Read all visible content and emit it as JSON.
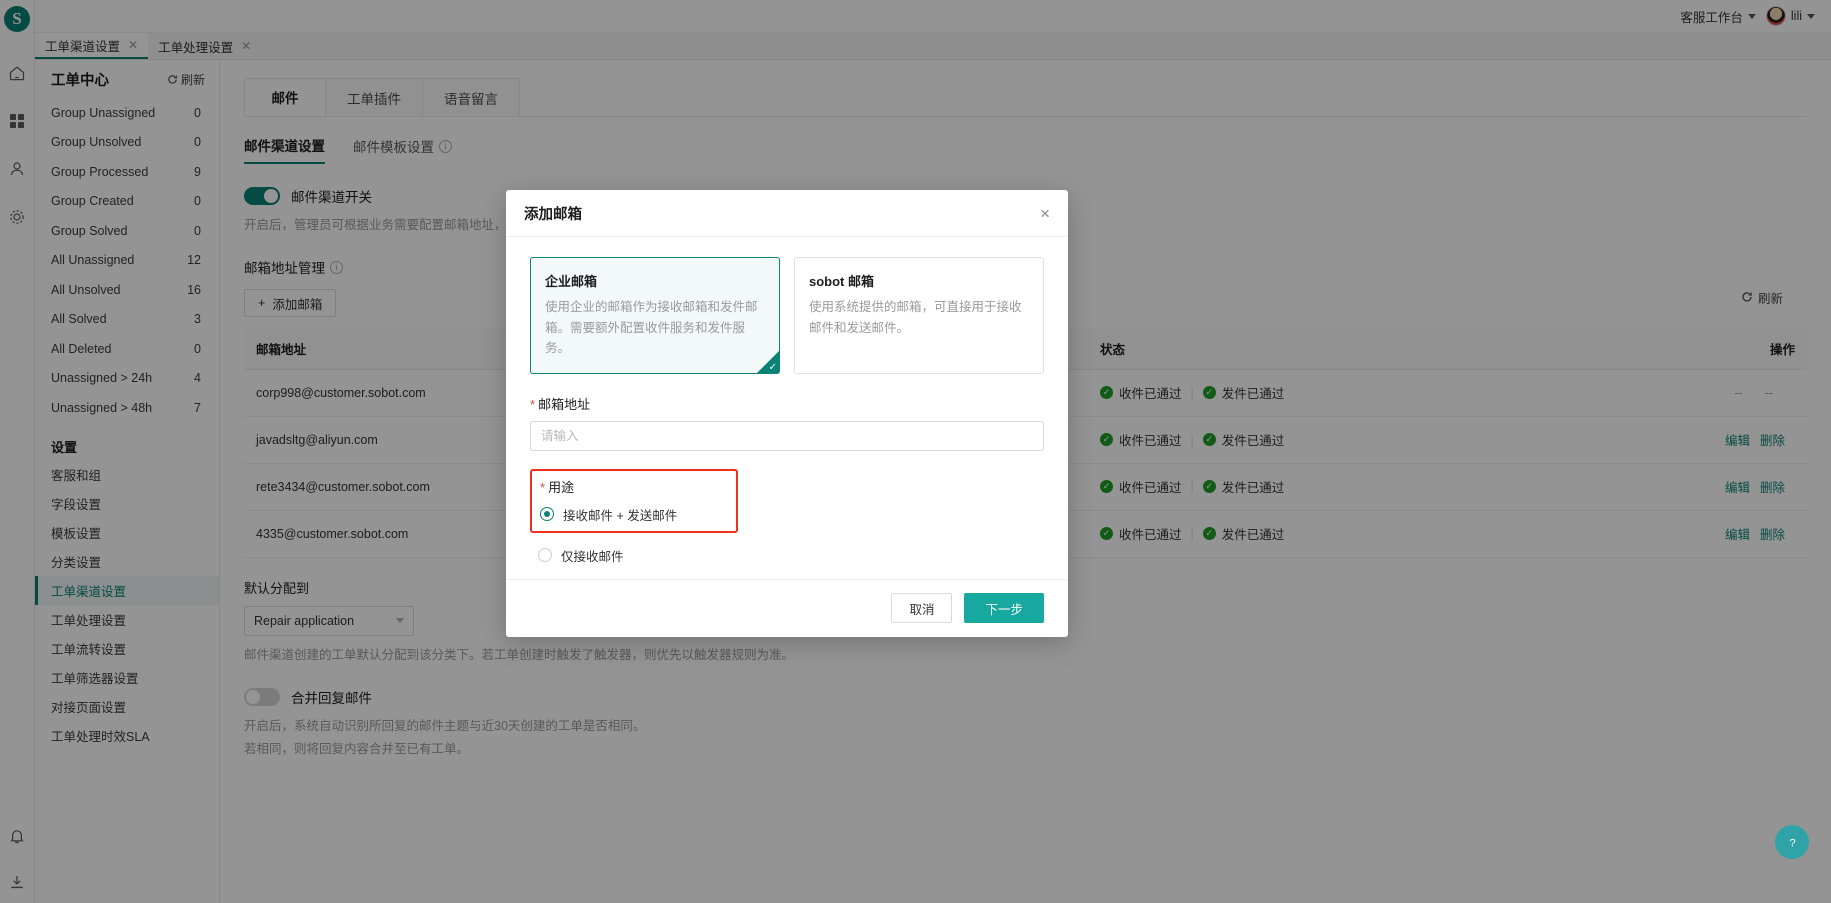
{
  "app": {
    "logo_letter": "S",
    "workbench_label": "客服工作台",
    "user_name": "lili"
  },
  "browser_tabs": [
    {
      "label": "工单渠道设置",
      "active": true
    },
    {
      "label": "工单处理设置",
      "active": false
    }
  ],
  "sidebar": {
    "title": "工单中心",
    "refresh_label": "刷新",
    "items": [
      {
        "label": "Group Unassigned",
        "count": "0"
      },
      {
        "label": "Group Unsolved",
        "count": "0"
      },
      {
        "label": "Group Processed",
        "count": "9"
      },
      {
        "label": "Group Created",
        "count": "0"
      },
      {
        "label": "Group Solved",
        "count": "0"
      },
      {
        "label": "All Unassigned",
        "count": "12"
      },
      {
        "label": "All Unsolved",
        "count": "16"
      },
      {
        "label": "All Solved",
        "count": "3"
      },
      {
        "label": "All Deleted",
        "count": "0"
      },
      {
        "label": "Unassigned > 24h",
        "count": "4"
      },
      {
        "label": "Unassigned > 48h",
        "count": "7"
      }
    ],
    "settings_header": "设置",
    "settings_items": [
      {
        "label": "客服和组",
        "active": false
      },
      {
        "label": "字段设置",
        "active": false
      },
      {
        "label": "模板设置",
        "active": false
      },
      {
        "label": "分类设置",
        "active": false
      },
      {
        "label": "工单渠道设置",
        "active": true
      },
      {
        "label": "工单处理设置",
        "active": false
      },
      {
        "label": "工单流转设置",
        "active": false
      },
      {
        "label": "工单筛选器设置",
        "active": false
      },
      {
        "label": "对接页面设置",
        "active": false
      },
      {
        "label": "工单处理时效SLA",
        "active": false
      }
    ]
  },
  "main": {
    "channel_tabs": [
      {
        "label": "邮件",
        "active": true
      },
      {
        "label": "工单插件",
        "active": false
      },
      {
        "label": "语音留言",
        "active": false
      }
    ],
    "sub_tabs": [
      {
        "label": "邮件渠道设置",
        "active": true,
        "info": false
      },
      {
        "label": "邮件模板设置",
        "active": false,
        "info": true
      }
    ],
    "channel_switch_label": "邮件渠道开关",
    "channel_switch_on": true,
    "channel_hint": "开启后，管理员可根据业务需要配置邮箱地址，客",
    "mailbox_manage_title": "邮箱地址管理",
    "add_mailbox_button": "添加邮箱",
    "refresh_label": "刷新",
    "table": {
      "columns": [
        "邮箱地址",
        "状态",
        "操作"
      ],
      "rows": [
        {
          "address": "corp998@customer.sobot.com",
          "status_receive": "收件已通过",
          "status_send": "发件已通过",
          "actions": [
            "--",
            "--"
          ],
          "actions_muted": true
        },
        {
          "address": "javadsltg@aliyun.com",
          "status_receive": "收件已通过",
          "status_send": "发件已通过",
          "actions": [
            "编辑",
            "删除"
          ],
          "actions_muted": false
        },
        {
          "address": "rete3434@customer.sobot.com",
          "status_receive": "收件已通过",
          "status_send": "发件已通过",
          "actions": [
            "编辑",
            "删除"
          ],
          "actions_muted": false
        },
        {
          "address": "4335@customer.sobot.com",
          "status_receive": "收件已通过",
          "status_send": "发件已通过",
          "actions": [
            "编辑",
            "删除"
          ],
          "actions_muted": false
        }
      ]
    },
    "default_assign_label": "默认分配到",
    "default_assign_value": "Repair application",
    "default_assign_hint": "邮件渠道创建的工单默认分配到该分类下。若工单创建时触发了触发器，则优先以触发器规则为准。",
    "merge_switch_label": "合并回复邮件",
    "merge_switch_on": false,
    "merge_hint_line1": "开启后，系统自动识别所回复的邮件主题与近30天创建的工单是否相同。",
    "merge_hint_line2": "若相同，则将回复内容合并至已有工单。"
  },
  "modal": {
    "title": "添加邮箱",
    "close_icon": "×",
    "options": [
      {
        "title": "企业邮箱",
        "desc": "使用企业的邮箱作为接收邮箱和发件邮箱。需要额外配置收件服务和发件服务。",
        "selected": true
      },
      {
        "title": "sobot 邮箱",
        "desc": "使用系统提供的邮箱，可直接用于接收邮件和发送邮件。",
        "selected": false
      }
    ],
    "email_label": "邮箱地址",
    "email_value": "",
    "email_placeholder": "请输入",
    "purpose_label": "用途",
    "purpose_options": [
      {
        "label": "接收邮件 + 发送邮件",
        "selected": true,
        "highlighted": true
      },
      {
        "label": "仅接收邮件",
        "selected": false,
        "highlighted": false
      }
    ],
    "cancel_label": "取消",
    "next_label": "下一步"
  },
  "colors": {
    "brand": "#0a8276",
    "primary_button": "#17a8a0",
    "highlight_border": "#f0301c",
    "success": "#1f9d28",
    "required": "#e8413a"
  }
}
